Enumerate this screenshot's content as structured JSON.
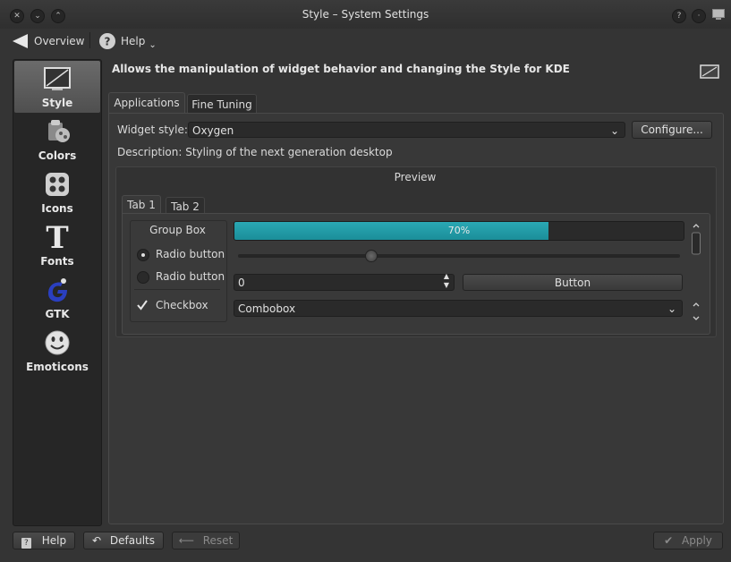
{
  "window": {
    "title": "Style – System Settings"
  },
  "toolbar": {
    "overview_label": "Overview",
    "help_label": "Help"
  },
  "sidebar": {
    "items": [
      {
        "label": "Style",
        "icon": "style-icon",
        "selected": true
      },
      {
        "label": "Colors",
        "icon": "colors-icon",
        "selected": false
      },
      {
        "label": "Icons",
        "icon": "icons-icon",
        "selected": false
      },
      {
        "label": "Fonts",
        "icon": "fonts-icon",
        "selected": false
      },
      {
        "label": "GTK",
        "icon": "gtk-icon",
        "selected": false
      },
      {
        "label": "Emoticons",
        "icon": "emoticons-icon",
        "selected": false
      }
    ]
  },
  "header": {
    "text": "Allows the manipulation of widget behavior and changing the Style for KDE"
  },
  "tabs": [
    {
      "label": "Applications",
      "active": true
    },
    {
      "label": "Fine Tuning",
      "active": false
    }
  ],
  "main": {
    "widget_style_label": "Widget style:",
    "widget_style_value": "Oxygen",
    "configure_label": "Configure...",
    "description_label": "Description:",
    "description_text": "Styling of the next generation desktop",
    "preview_title": "Preview"
  },
  "preview": {
    "tabs": [
      {
        "label": "Tab 1",
        "active": true
      },
      {
        "label": "Tab 2",
        "active": false
      }
    ],
    "group_box_title": "Group Box",
    "radio1_label": "Radio button",
    "radio2_label": "Radio button",
    "checkbox_label": "Checkbox",
    "progress_value": 0.7,
    "progress_text": "70%",
    "slider_value": 0.3,
    "spinbox_value": "0",
    "button_label": "Button",
    "combobox_value": "Combobox"
  },
  "bottom": {
    "help_label": "Help",
    "defaults_label": "Defaults",
    "reset_label": "Reset",
    "apply_label": "Apply"
  },
  "colors": {
    "accent": "#2aa8b4",
    "background": "#343434"
  }
}
